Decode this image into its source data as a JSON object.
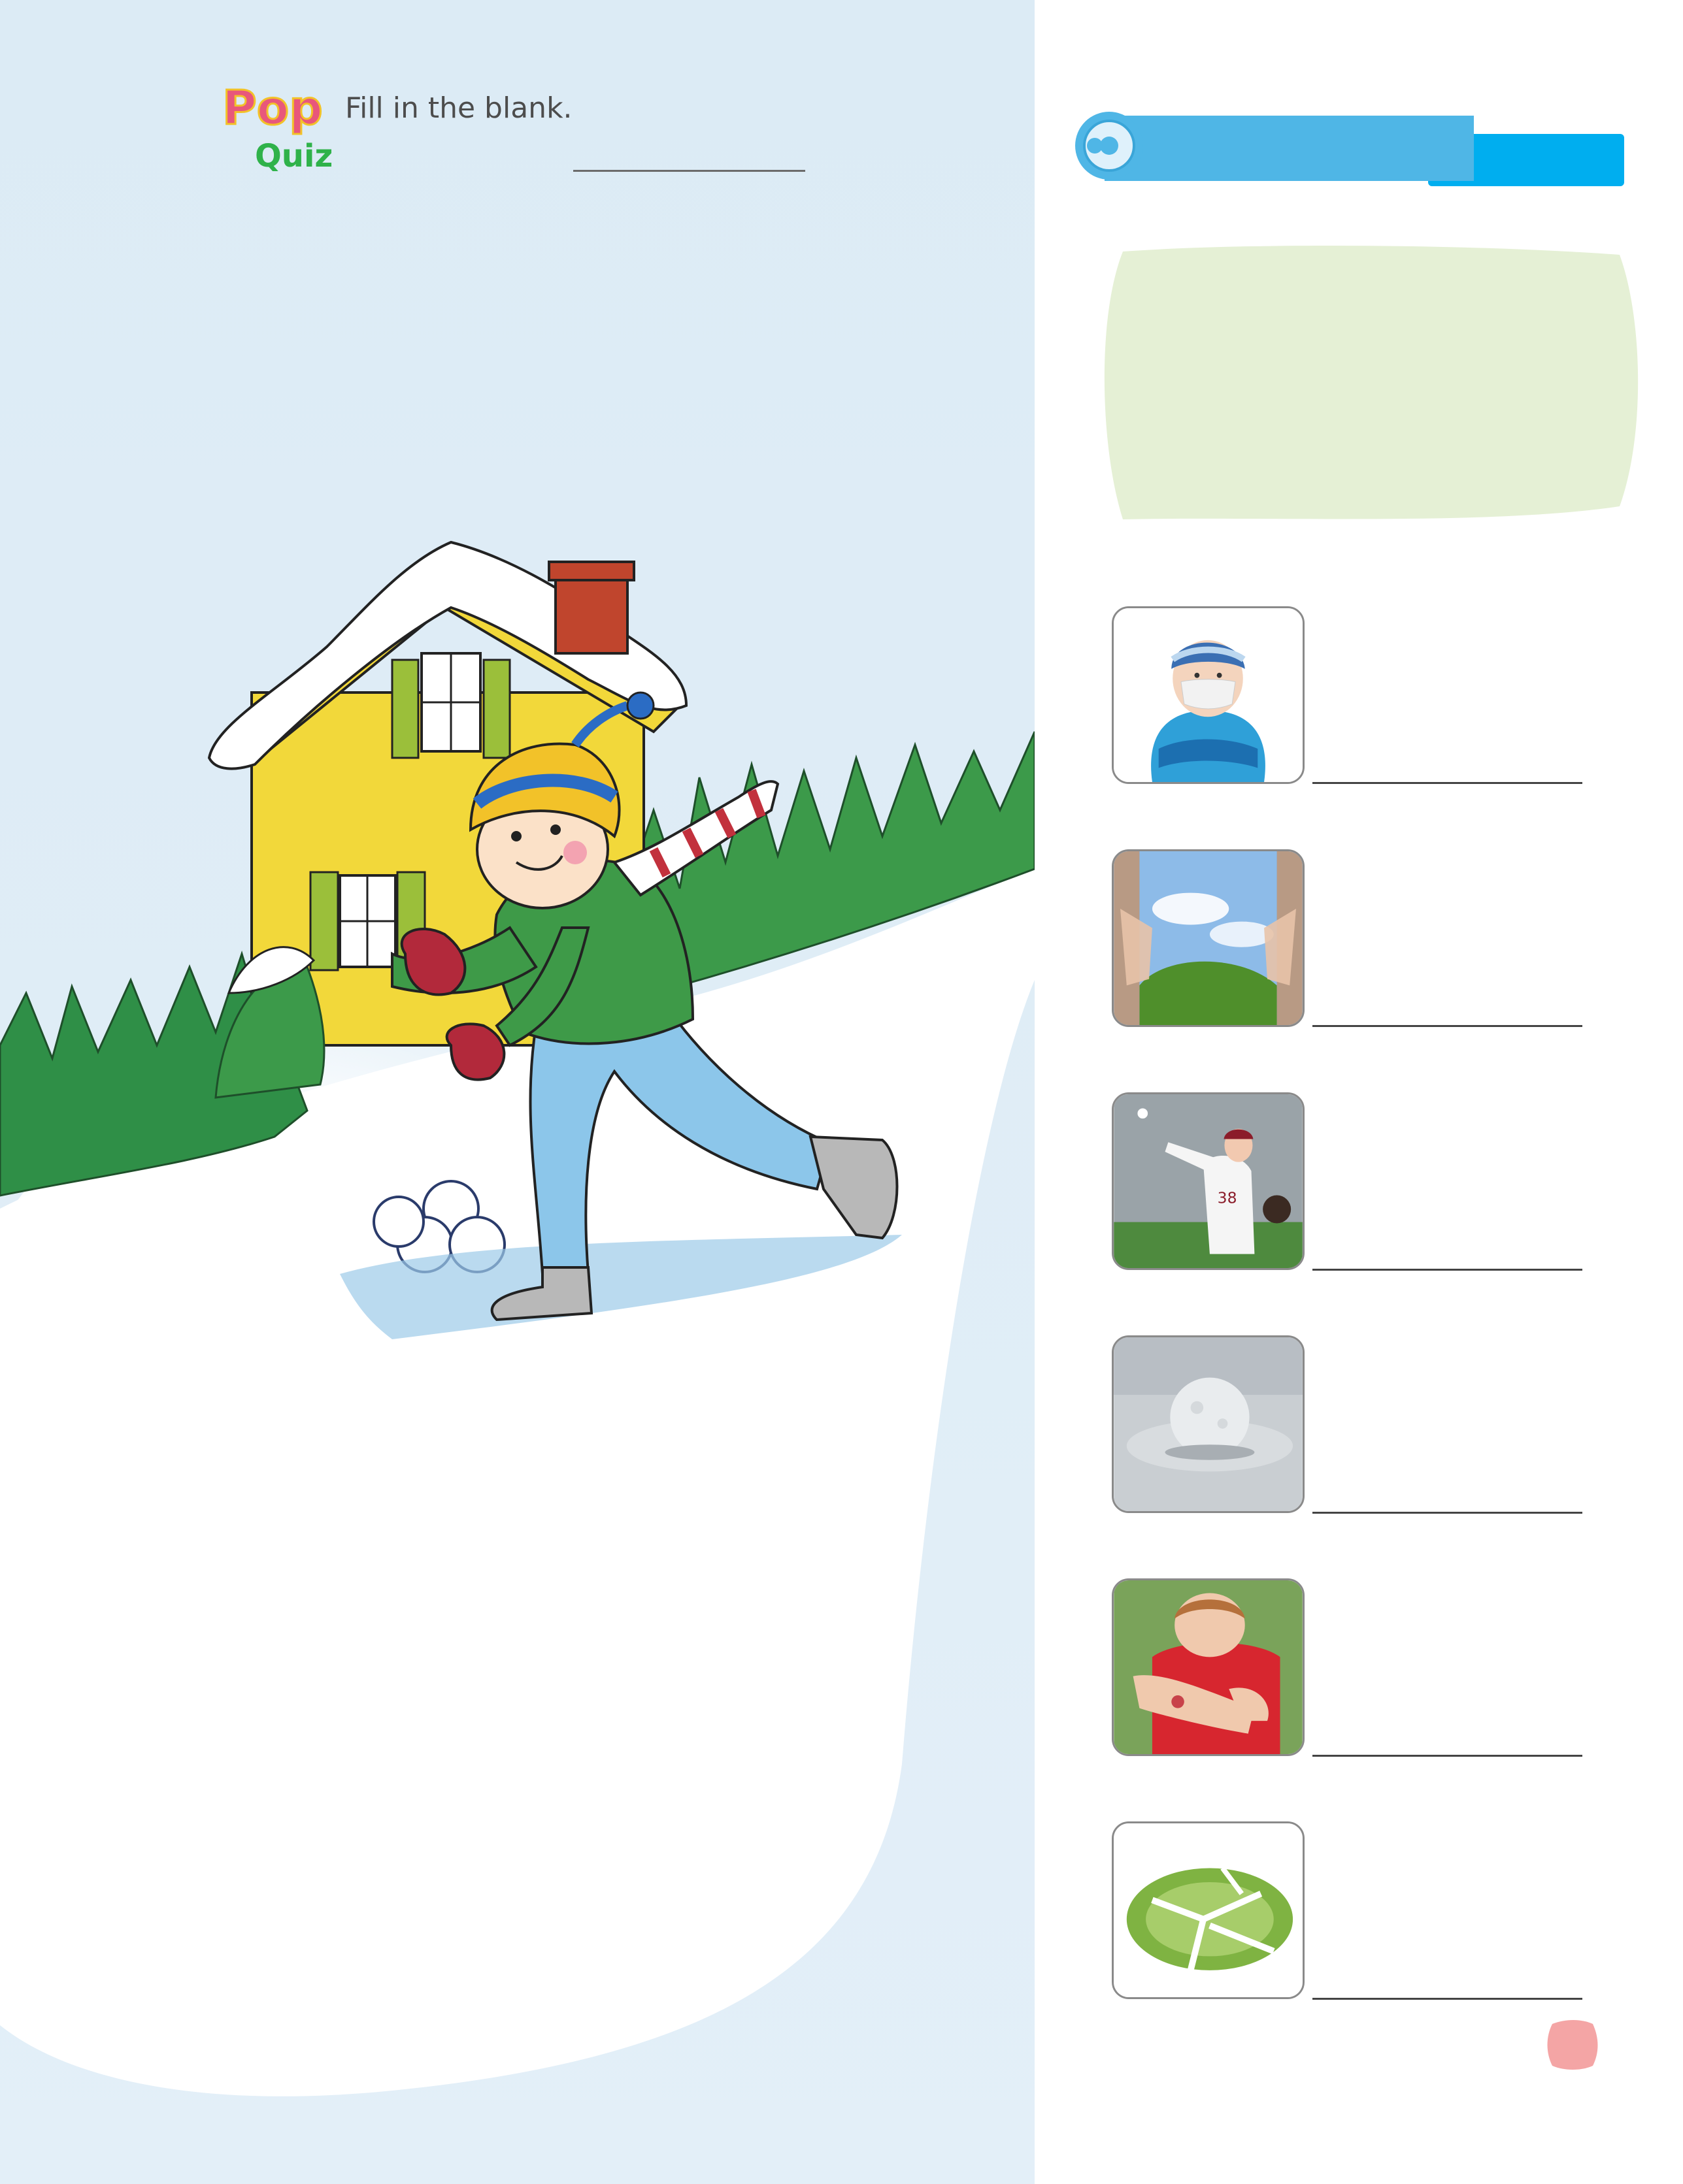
{
  "pop_quiz": {
    "logo_top": "Pop",
    "logo_bottom": "Quiz",
    "instruction": "Fill in the blank."
  },
  "colors": {
    "left_sky": "#dcebf5",
    "tag_blue": "#4fb6e6",
    "bubble_green": "#e5f0d5",
    "page_badge": "#f4a5a5"
  },
  "vocabulary_items": [
    {
      "icon": "cold-boy-photo"
    },
    {
      "icon": "open-window-photo"
    },
    {
      "icon": "baseball-pitcher-photo"
    },
    {
      "icon": "snowball-photo"
    },
    {
      "icon": "hurt-elbow-photo"
    },
    {
      "icon": "broken-plate-photo"
    }
  ]
}
